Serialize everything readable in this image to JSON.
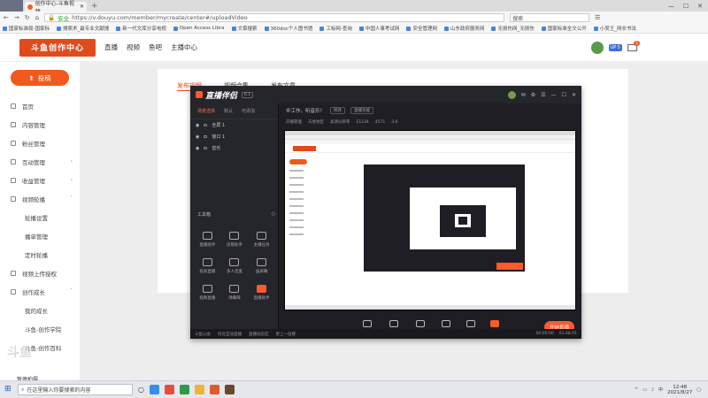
{
  "browser": {
    "tab_title": "创作中心-斗鱼视频",
    "address": "https://v.douyu.com/member/mycreate/center#/uploadVideo",
    "secure_label": "安全",
    "search_placeholder": "搜索",
    "bookmarks": [
      "国家标准局-国家标",
      "搜索术_最专业文献搜",
      "新一代文库分享电视",
      "Open Access Libra",
      "文章搜索",
      "360doc个人图书馆",
      "工标网-查询",
      "中国人事考试网",
      "安全管理网",
      "山东政府服务网",
      "无损伤网_无损伤",
      "国家标准全文公开",
      "小吴王_网长书法"
    ]
  },
  "site": {
    "logo_text": "斗鱼创作中心",
    "nav": [
      "直播",
      "视频",
      "鱼吧",
      "主播中心"
    ],
    "level": "UP 5",
    "mail_count": "1"
  },
  "sidebar": {
    "upload_label": "投稿",
    "items": [
      {
        "label": "首页"
      },
      {
        "label": "内容管理"
      },
      {
        "label": "粉丝管理"
      },
      {
        "label": "互动管理"
      },
      {
        "label": "收益管理"
      },
      {
        "label": "视频轮播"
      },
      {
        "label": "轮播设置"
      },
      {
        "label": "播单管理"
      },
      {
        "label": "定时轮播"
      },
      {
        "label": "视频上传授权"
      },
      {
        "label": "创作成长"
      },
      {
        "label": "我的成长"
      },
      {
        "label": "斗鱼-创作学院"
      },
      {
        "label": "斗鱼-创作百科"
      }
    ]
  },
  "content": {
    "tabs": [
      "发布视频",
      "视频合集",
      "发布文章"
    ]
  },
  "app": {
    "logo": "直播伴侣",
    "version": "6.1",
    "panel_tabs": [
      "场景选择",
      "默认",
      "可添加"
    ],
    "scenes": [
      "全屏 1",
      "窗口 1",
      "音乐"
    ],
    "tools_title": "工具箱",
    "tools": [
      "直播助手",
      "房管助手",
      "主播任务",
      "投屏直播",
      "多人连麦",
      "画屏幕",
      "视频直播",
      "弹幕库",
      "直播助手"
    ],
    "main_title": "伞工作，听音乐！",
    "main_tag": "修改",
    "main_sub": "直播功能",
    "stats": [
      "开播管理",
      "天地地区",
      "高清分辨率",
      "E1234",
      "4571",
      "3.8"
    ],
    "bottom_tools": [
      "直播屏幕",
      "摄像头",
      "手机投屏",
      "多媒体",
      "麦克风",
      "扬声器"
    ],
    "golive": "开始直播",
    "status_left": [
      "斗鱼公会",
      "优化互动直播",
      "直播动态区",
      "更上一层楼"
    ],
    "status_right": [
      "00:00:00",
      "01:48:01"
    ]
  },
  "taskbar": {
    "search_placeholder": "在这里输入你要搜索的内容",
    "time": "12:48",
    "date": "2021/8/27"
  },
  "overlay": {
    "bottom_label": "暂停拍摄"
  }
}
